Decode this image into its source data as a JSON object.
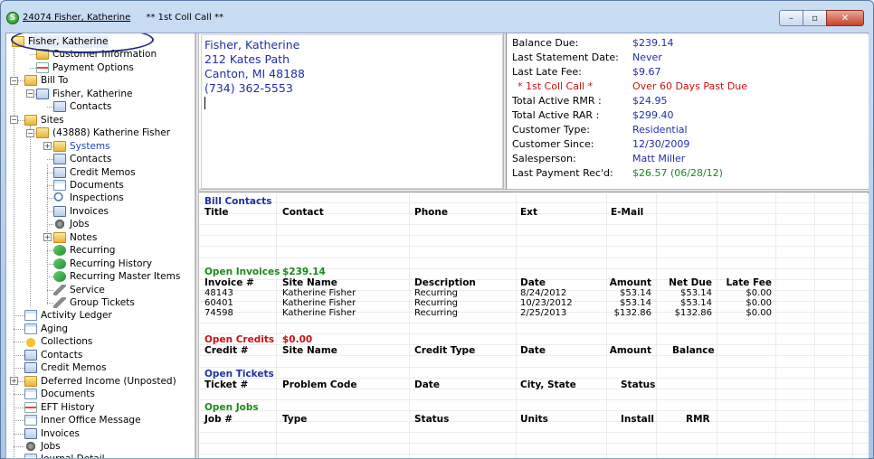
{
  "window": {
    "title_id_name": "24074 Fisher, Katherine",
    "title_status": "** 1st Coll Call **",
    "btn_min": "–",
    "btn_max": "▫",
    "btn_close": "✕"
  },
  "tree": {
    "items": [
      {
        "label": "Fisher, Katherine",
        "icon": "folder-open-icon"
      },
      {
        "label": "Customer Information",
        "icon": "folder-icon"
      },
      {
        "label": "Payment Options",
        "icon": "payment-icon"
      },
      {
        "label": "Bill To",
        "icon": "folder-icon"
      },
      {
        "label": "Fisher, Katherine",
        "icon": "address-card-icon"
      },
      {
        "label": "Contacts",
        "icon": "contacts-icon"
      },
      {
        "label": "Sites",
        "icon": "folder-icon"
      },
      {
        "label": "(43888) Katherine Fisher",
        "icon": "folder-icon"
      },
      {
        "label": "Systems",
        "icon": "folder-icon"
      },
      {
        "label": "Contacts",
        "icon": "contacts-icon"
      },
      {
        "label": "Credit Memos",
        "icon": "credit-memo-icon"
      },
      {
        "label": "Documents",
        "icon": "document-icon"
      },
      {
        "label": "Inspections",
        "icon": "inspection-icon"
      },
      {
        "label": "Invoices",
        "icon": "invoice-icon"
      },
      {
        "label": "Jobs",
        "icon": "jobs-icon"
      },
      {
        "label": "Notes",
        "icon": "folder-icon"
      },
      {
        "label": "Recurring",
        "icon": "recurring-icon"
      },
      {
        "label": "Recurring History",
        "icon": "recurring-history-icon"
      },
      {
        "label": "Recurring Master Items",
        "icon": "recurring-master-icon"
      },
      {
        "label": "Service",
        "icon": "service-icon"
      },
      {
        "label": "Group Tickets",
        "icon": "group-tickets-icon"
      },
      {
        "label": "Activity Ledger",
        "icon": "ledger-icon"
      },
      {
        "label": "Aging",
        "icon": "aging-icon"
      },
      {
        "label": "Collections",
        "icon": "collections-icon"
      },
      {
        "label": "Contacts",
        "icon": "contacts-icon"
      },
      {
        "label": "Credit Memos",
        "icon": "credit-memo-icon"
      },
      {
        "label": "Deferred Income (Unposted)",
        "icon": "folder-icon"
      },
      {
        "label": "Documents",
        "icon": "document-icon"
      },
      {
        "label": "EFT History",
        "icon": "eft-icon"
      },
      {
        "label": "Inner Office Message",
        "icon": "message-icon"
      },
      {
        "label": "Invoices",
        "icon": "invoice-icon"
      },
      {
        "label": "Jobs",
        "icon": "jobs-icon"
      },
      {
        "label": "Journal Detail",
        "icon": "journal-icon"
      }
    ]
  },
  "address": {
    "name": "Fisher, Katherine",
    "street": "212  Kates Path",
    "city": "Canton, MI  48188",
    "phone": "(734) 362-5553"
  },
  "summary": [
    {
      "label": "Balance Due:",
      "value": "$239.14",
      "color": "#1f2fa8"
    },
    {
      "label": "Last Statement Date:",
      "value": "Never",
      "color": "#1f2fa8"
    },
    {
      "label": "Last Late Fee:",
      "value": "$9.67",
      "color": "#1f2fa8"
    },
    {
      "label": "* 1st Coll Call *",
      "value": "Over 60 Days Past Due",
      "color": "#d01010"
    },
    {
      "label": "Total Active RMR :",
      "value": "$24.95",
      "color": "#1f2fa8"
    },
    {
      "label": "Total Active RAR :",
      "value": "$299.40",
      "color": "#1f2fa8"
    },
    {
      "label": "Customer Type:",
      "value": "Residential",
      "color": "#1f2fa8"
    },
    {
      "label": "Customer Since:",
      "value": "12/30/2009",
      "color": "#1f2fa8"
    },
    {
      "label": "Salesperson:",
      "value": "Matt Miller",
      "color": "#1f2fa8"
    },
    {
      "label": "Last Payment Rec'd:",
      "value": "$26.57 (06/28/12)",
      "color": "#1a8a1a"
    }
  ],
  "detail": {
    "bill_contacts": {
      "title": "Bill Contacts",
      "headers": [
        "Title",
        "Contact",
        "Phone",
        "Ext",
        "E-Mail"
      ]
    },
    "open_invoices": {
      "title": "Open Invoices",
      "total": "$239.14",
      "headers": [
        "Invoice #",
        "Site Name",
        "Description",
        "Date",
        "Amount",
        "Net Due",
        "Late Fee"
      ],
      "rows": [
        [
          "48143",
          "Katherine Fisher",
          "Recurring",
          "8/24/2012",
          "$53.14",
          "$53.14",
          "$0.00"
        ],
        [
          "60401",
          "Katherine Fisher",
          "Recurring",
          "10/23/2012",
          "$53.14",
          "$53.14",
          "$0.00"
        ],
        [
          "74598",
          "Katherine Fisher",
          "Recurring",
          "2/25/2013",
          "$132.86",
          "$132.86",
          "$0.00"
        ]
      ]
    },
    "open_credits": {
      "title": "Open Credits",
      "total": "$0.00",
      "headers": [
        "Credit #",
        "Site Name",
        "Credit Type",
        "Date",
        "Amount",
        "Balance"
      ]
    },
    "open_tickets": {
      "title": "Open Tickets",
      "headers": [
        "Ticket #",
        "Problem Code",
        "Date",
        "City, State",
        "Status"
      ]
    },
    "open_jobs": {
      "title": "Open Jobs",
      "headers": [
        "Job #",
        "Type",
        "Status",
        "Units",
        "Install",
        "RMR"
      ]
    }
  }
}
